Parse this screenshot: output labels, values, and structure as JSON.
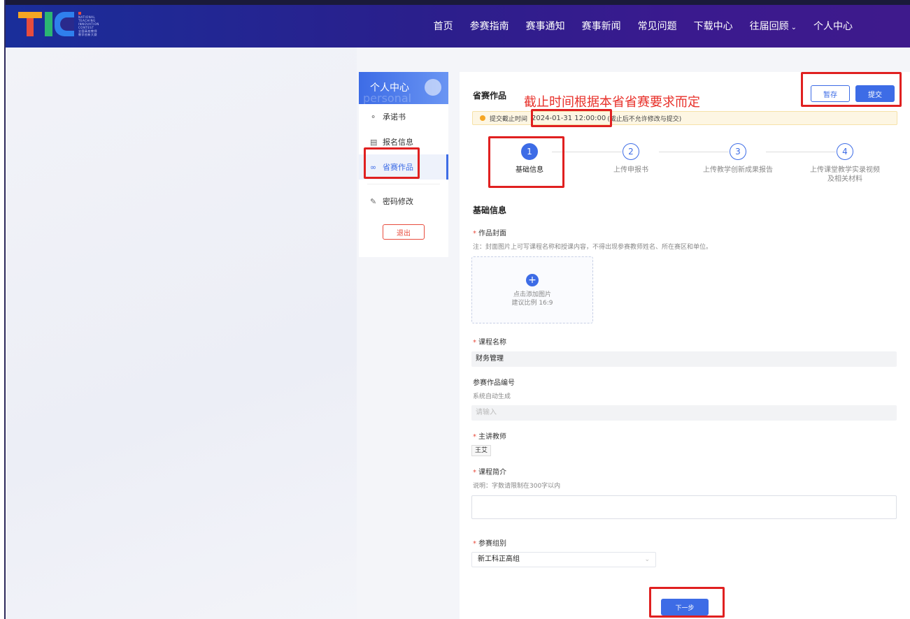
{
  "header": {
    "logo_lines": [
      "NATIONAL",
      "TEACHING",
      "INNOVATION",
      "CONTEST",
      "全国高校教师",
      "教学创新大赛"
    ],
    "nav": [
      {
        "label": "首页"
      },
      {
        "label": "参赛指南"
      },
      {
        "label": "赛事通知"
      },
      {
        "label": "赛事新闻"
      },
      {
        "label": "常见问题"
      },
      {
        "label": "下载中心"
      },
      {
        "label": "往届回顾",
        "has_dropdown": true
      },
      {
        "label": "个人中心"
      }
    ],
    "gradient_colors": [
      "#1a2e9a",
      "#3e1a8c"
    ]
  },
  "sidebar": {
    "title": "个人中心",
    "ghost_text": "personal",
    "items": [
      {
        "label": "承诺书",
        "icon": "shield-icon"
      },
      {
        "label": "报名信息",
        "icon": "form-icon"
      },
      {
        "label": "省赛作品",
        "icon": "link-icon",
        "active": true
      },
      {
        "label": "密码修改",
        "icon": "edit-icon"
      }
    ],
    "logout": "退出"
  },
  "main": {
    "title": "省赛作品",
    "annotation": "截止时间根据本省省赛要求而定",
    "save_label": "暂存",
    "submit_label": "提交",
    "notice": {
      "prefix": "提交截止时间",
      "deadline": "2024-01-31 12:00:00",
      "suffix": "(截止后不允许修改与提交)"
    },
    "steps": [
      {
        "num": "1",
        "label": "基础信息",
        "active": true
      },
      {
        "num": "2",
        "label": "上传申报书"
      },
      {
        "num": "3",
        "label": "上传教学创新成果报告"
      },
      {
        "num": "4",
        "label": "上传课堂教学实录视频",
        "label2": "及相关材料"
      }
    ],
    "section_title": "基础信息",
    "cover": {
      "label": "作品封面",
      "hint": "注：封面图片上可写课程名称和授课内容，不得出现参赛教师姓名、所在赛区和单位。",
      "upload_text": "点击添加图片",
      "upload_ratio": "建议比例 16:9"
    },
    "course_name": {
      "label": "课程名称",
      "value": "财务管理"
    },
    "work_id": {
      "label": "参赛作品编号",
      "hint": "系统自动生成",
      "placeholder": "请输入"
    },
    "teacher": {
      "label": "主讲教师",
      "value": "王艾"
    },
    "intro": {
      "label": "课程简介",
      "hint": "说明：字数请限制在300字以内",
      "value": ""
    },
    "group": {
      "label": "参赛组别",
      "value": "新工科正高组"
    },
    "next_label": "下一步",
    "accent": "#3d6ce6",
    "annotation_color": "#e02020"
  }
}
